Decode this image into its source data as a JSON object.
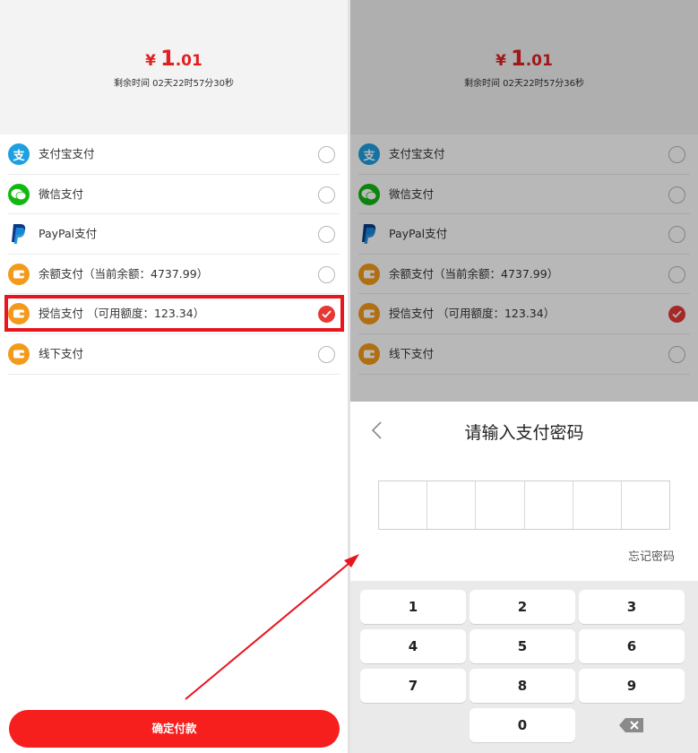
{
  "left": {
    "currency": "¥",
    "amount_int": "1",
    "amount_dec": ".01",
    "remaining": "剩余时间 02天22时57分30秒",
    "methods": [
      {
        "label": "支付宝支付",
        "icon": "alipay-icon",
        "checked": false
      },
      {
        "label": "微信支付",
        "icon": "wechat-icon",
        "checked": false
      },
      {
        "label": "PayPal支付",
        "icon": "paypal-icon",
        "checked": false
      },
      {
        "label": "余额支付（当前余额：4737.99）",
        "icon": "wallet-icon",
        "checked": false
      },
      {
        "label": "授信支付 （可用额度：123.34）",
        "icon": "wallet-icon",
        "checked": true
      },
      {
        "label": "线下支付",
        "icon": "wallet-icon",
        "checked": false
      }
    ],
    "confirm_label": "确定付款"
  },
  "right": {
    "currency": "¥",
    "amount_int": "1",
    "amount_dec": ".01",
    "remaining": "剩余时间 02天22时57分36秒",
    "methods": [
      {
        "label": "支付宝支付",
        "icon": "alipay-icon",
        "checked": false
      },
      {
        "label": "微信支付",
        "icon": "wechat-icon",
        "checked": false
      },
      {
        "label": "PayPal支付",
        "icon": "paypal-icon",
        "checked": false
      },
      {
        "label": "余额支付（当前余额：4737.99）",
        "icon": "wallet-icon",
        "checked": false
      },
      {
        "label": "授信支付 （可用额度：123.34）",
        "icon": "wallet-icon",
        "checked": true
      },
      {
        "label": "线下支付",
        "icon": "wallet-icon",
        "checked": false
      }
    ],
    "password_dialog": {
      "title": "请输入支付密码",
      "forgot_label": "忘记密码",
      "keys": [
        "1",
        "2",
        "3",
        "4",
        "5",
        "6",
        "7",
        "8",
        "9",
        "0"
      ],
      "delete_icon": "backspace-icon",
      "back_icon": "chevron-left-icon"
    }
  },
  "colors": {
    "accent": "#f71e1e",
    "price": "#e02020",
    "alipay": "#1e9fe0",
    "wechat": "#12b712",
    "wallet": "#f49a1a",
    "highlight": "#e8141e"
  },
  "icon_glyphs": {
    "alipay": "支"
  }
}
